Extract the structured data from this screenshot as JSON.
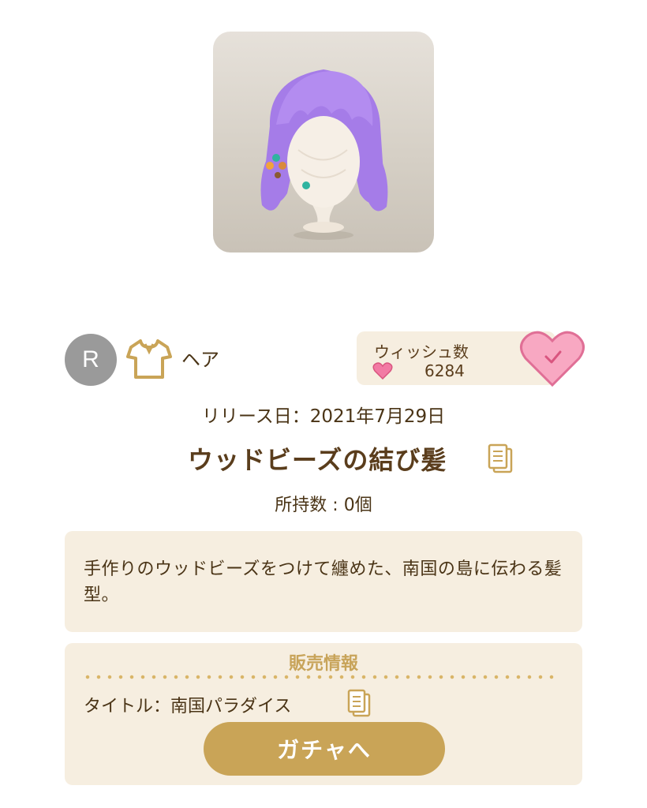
{
  "item": {
    "rarity": "R",
    "category_icon": "shirt-icon",
    "category": "ヘア",
    "release_date": "リリース日：2021年7月29日",
    "name": "ウッドビーズの結び髪",
    "owned": "所持数 : 0個",
    "description": "手作りのウッドビーズをつけて纏めた、南国の島に伝わる髪型。"
  },
  "wish": {
    "label": "ウィッシュ数",
    "count": "6284",
    "heart_color": "#f27aa4"
  },
  "sales": {
    "header": "販売情報",
    "title": "タイトル：南国パラダイス",
    "button_label": "ガチャへ"
  },
  "colors": {
    "accent": "#c9a457",
    "panel": "#f6eee0",
    "text": "#5a3d1c"
  }
}
